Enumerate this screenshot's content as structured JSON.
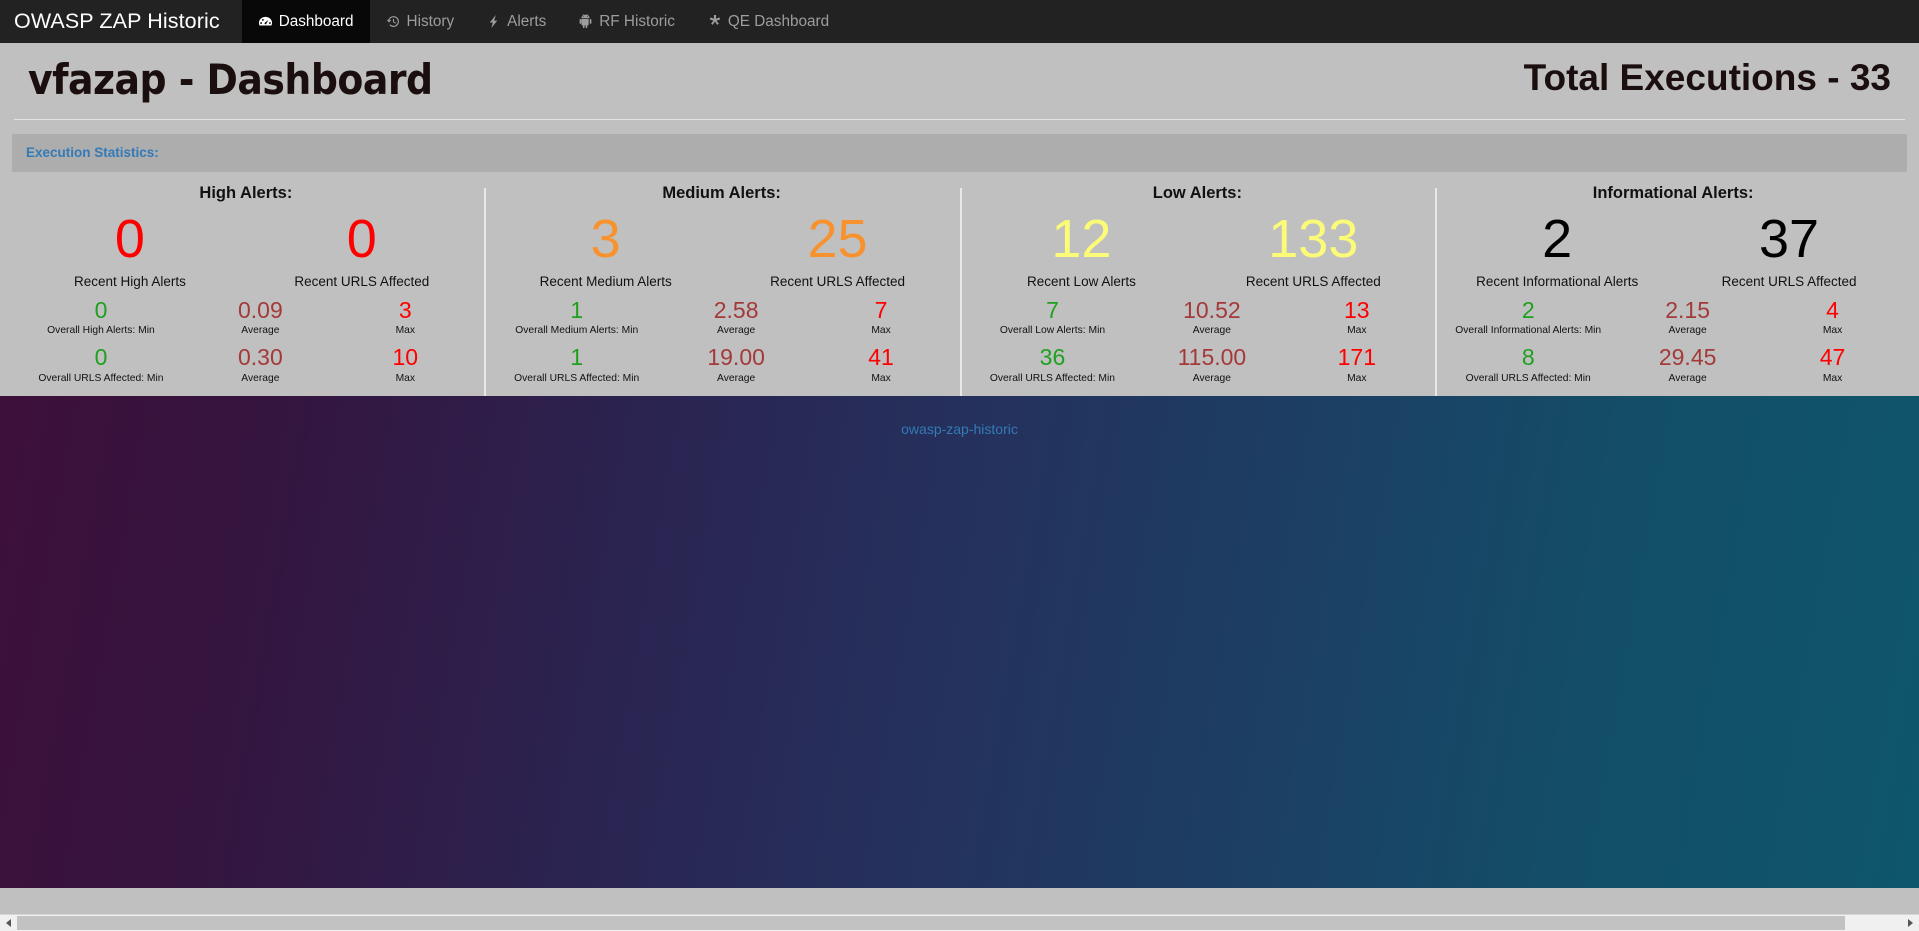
{
  "navbar": {
    "brand": "OWASP ZAP Historic",
    "items": [
      {
        "label": "Dashboard",
        "icon": "tachometer-icon",
        "active": true
      },
      {
        "label": "History",
        "icon": "history-icon",
        "active": false
      },
      {
        "label": "Alerts",
        "icon": "bolt-icon",
        "active": false
      },
      {
        "label": "RF Historic",
        "icon": "android-icon",
        "active": false
      },
      {
        "label": "QE Dashboard",
        "icon": "asterisk-icon",
        "active": false
      }
    ]
  },
  "header": {
    "title": "vfazap - Dashboard",
    "total_executions": "Total Executions - 33"
  },
  "section": {
    "title": "Execution Statistics:"
  },
  "colors": {
    "high": "#ff0000",
    "medium": "#f8922e",
    "low": "#fbfb78",
    "informational": "#000000",
    "min": "#1fa01f",
    "average": "#a33a3a",
    "max": "#ff0000",
    "accent_link": "#337ab7",
    "navbar_bg": "#222222",
    "page_bg": "#c0c0c0"
  },
  "panels": [
    {
      "title": "High Alerts:",
      "severity_color_class": "c-red",
      "recent_alerts": {
        "value": "0",
        "caption": "Recent High Alerts"
      },
      "recent_urls": {
        "value": "0",
        "caption": "Recent URLS Affected"
      },
      "alerts_row": {
        "min_value": "0",
        "min_label": "Overall High Alerts: Min",
        "avg_value": "0.09",
        "avg_label": "Average",
        "max_value": "3",
        "max_label": "Max"
      },
      "urls_row": {
        "min_value": "0",
        "min_label": "Overall URLS Affected: Min",
        "avg_value": "0.30",
        "avg_label": "Average",
        "max_value": "10",
        "max_label": "Max"
      }
    },
    {
      "title": "Medium Alerts:",
      "severity_color_class": "c-orange",
      "recent_alerts": {
        "value": "3",
        "caption": "Recent Medium Alerts"
      },
      "recent_urls": {
        "value": "25",
        "caption": "Recent URLS Affected"
      },
      "alerts_row": {
        "min_value": "1",
        "min_label": "Overall Medium Alerts: Min",
        "avg_value": "2.58",
        "avg_label": "Average",
        "max_value": "7",
        "max_label": "Max"
      },
      "urls_row": {
        "min_value": "1",
        "min_label": "Overall URLS Affected: Min",
        "avg_value": "19.00",
        "avg_label": "Average",
        "max_value": "41",
        "max_label": "Max"
      }
    },
    {
      "title": "Low Alerts:",
      "severity_color_class": "c-yellow",
      "recent_alerts": {
        "value": "12",
        "caption": "Recent Low Alerts"
      },
      "recent_urls": {
        "value": "133",
        "caption": "Recent URLS Affected"
      },
      "alerts_row": {
        "min_value": "7",
        "min_label": "Overall Low Alerts: Min",
        "avg_value": "10.52",
        "avg_label": "Average",
        "max_value": "13",
        "max_label": "Max"
      },
      "urls_row": {
        "min_value": "36",
        "min_label": "Overall URLS Affected: Min",
        "avg_value": "115.00",
        "avg_label": "Average",
        "max_value": "171",
        "max_label": "Max"
      }
    },
    {
      "title": "Informational Alerts:",
      "severity_color_class": "c-black",
      "recent_alerts": {
        "value": "2",
        "caption": "Recent Informational Alerts"
      },
      "recent_urls": {
        "value": "37",
        "caption": "Recent URLS Affected"
      },
      "alerts_row": {
        "min_value": "2",
        "min_label": "Overall Informational Alerts: Min",
        "avg_value": "2.15",
        "avg_label": "Average",
        "max_value": "4",
        "max_label": "Max"
      },
      "urls_row": {
        "min_value": "8",
        "min_label": "Overall URLS Affected: Min",
        "avg_value": "29.45",
        "avg_label": "Average",
        "max_value": "47",
        "max_label": "Max"
      }
    }
  ],
  "hero": {
    "link_label": "owasp-zap-historic"
  }
}
